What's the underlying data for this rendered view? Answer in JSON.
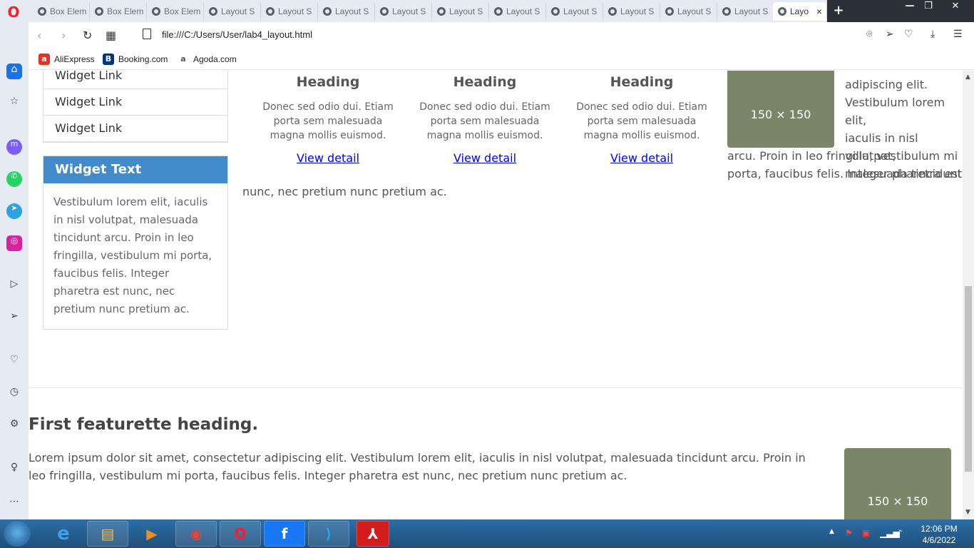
{
  "browser": {
    "tabs": [
      "Box Elem",
      "Box Elem",
      "Box Elem",
      "Layout S",
      "Layout S",
      "Layout S",
      "Layout S",
      "Layout S",
      "Layout S",
      "Layout S",
      "Layout S",
      "Layout S",
      "Layout S",
      "Layo"
    ],
    "active_tab_close": "×",
    "url": "file:///C:/Users/User/lab4_layout.html",
    "bookmarks": [
      {
        "label": "AliExpress",
        "icon": "aliexpress-icon",
        "color": "#e43225"
      },
      {
        "label": "Booking.com",
        "icon": "booking-icon",
        "color": "#003580"
      },
      {
        "label": "Agoda.com",
        "icon": "agoda-icon",
        "color": "#555555"
      }
    ]
  },
  "page": {
    "widget_links": [
      "Widget Link",
      "Widget Link",
      "Widget Link"
    ],
    "widget_text": {
      "heading": "Widget Text",
      "body": "Vestibulum lorem elit, iaculis in nisl volutpat, malesuada tincidunt arcu. Proin in leo fringilla, vestibulum mi porta, faucibus felis. Integer pharetra est nunc, nec pretium nunc pretium ac."
    },
    "columns": [
      {
        "heading": "Heading",
        "text": "Donec sed odio dui. Etiam porta sem malesuada magna mollis euismod.",
        "link": "View detail"
      },
      {
        "heading": "Heading",
        "text": "Donec sed odio dui. Etiam porta sem malesuada magna mollis euismod.",
        "link": "View detail"
      },
      {
        "heading": "Heading",
        "text": "Donec sed odio dui. Etiam porta sem malesuada magna mollis euismod.",
        "link": "View detail"
      }
    ],
    "placeholder_label": "150 × 150",
    "media_text_right_lines": [
      "adipiscing elit.",
      "Vestibulum lorem elit,",
      "iaculis in nisl volutpat,",
      "malesuada tincidunt"
    ],
    "media_text_wrap_1": "arcu. Proin in leo fringilla, vestibulum mi",
    "media_text_wrap_2": "porta, faucibus felis. Integer pharetra est",
    "media_text_wrap_3": "nunc, nec pretium nunc pretium ac.",
    "featurette": {
      "heading": "First featurette heading.",
      "text": "Lorem ipsum dolor sit amet, consectetur adipiscing elit. Vestibulum lorem elit, iaculis in nisl volutpat, malesuada tincidunt arcu. Proin in leo fringilla, vestibulum mi porta, faucibus felis. Integer pharetra est nunc, nec pretium nunc pretium ac.",
      "placeholder_label": "150 × 150"
    },
    "placeholder_color": "#7b8669"
  },
  "taskbar": {
    "time": "12:06 PM",
    "date": "4/6/2022",
    "apps": [
      "internet-explorer-icon",
      "file-explorer-icon",
      "media-player-icon",
      "chrome-icon",
      "opera-icon",
      "facebook-icon",
      "vscode-icon",
      "acrobat-icon"
    ]
  }
}
